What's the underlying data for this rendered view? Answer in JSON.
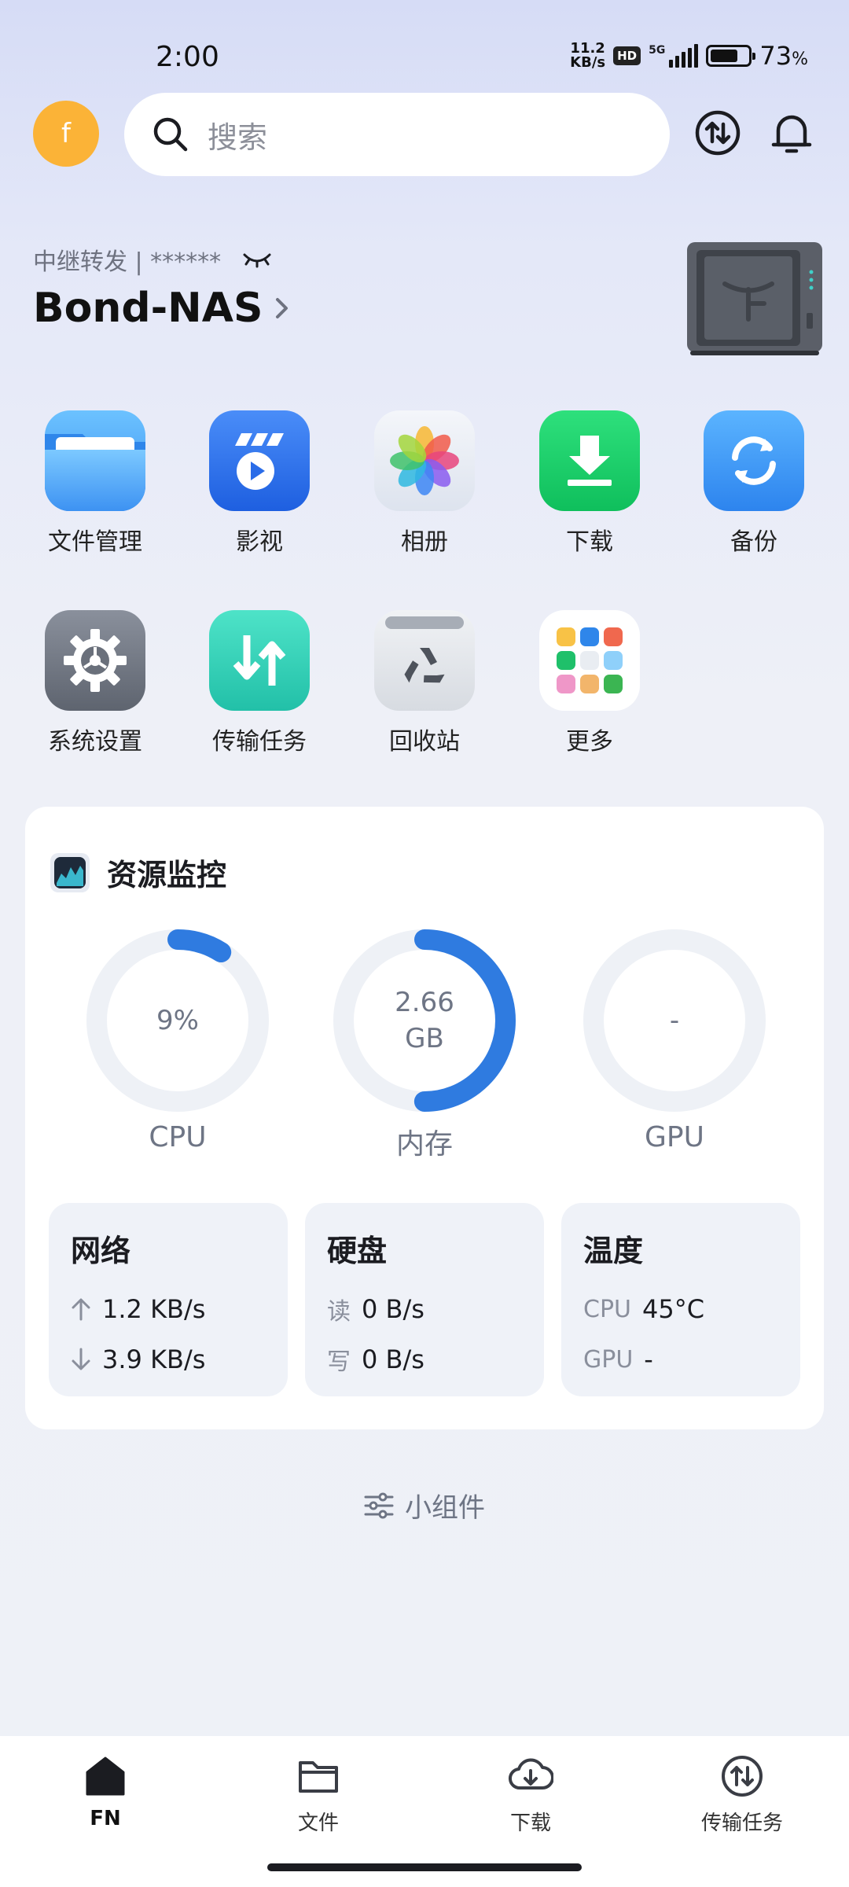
{
  "status_bar": {
    "time": "2:00",
    "net_speed_value": "11.2",
    "net_speed_unit": "KB/s",
    "hd": "HD",
    "network": "5G",
    "battery_level": 0.73,
    "battery_pct": "73",
    "battery_unit": "%"
  },
  "header": {
    "avatar_letter": "f",
    "search_placeholder": "搜索"
  },
  "device": {
    "relay": "中继转发 | ******",
    "name": "Bond-NAS"
  },
  "apps": [
    {
      "label": "文件管理",
      "icon": "folder-icon"
    },
    {
      "label": "影视",
      "icon": "video-icon"
    },
    {
      "label": "相册",
      "icon": "photos-icon"
    },
    {
      "label": "下载",
      "icon": "download-icon"
    },
    {
      "label": "备份",
      "icon": "backup-icon"
    },
    {
      "label": "系统设置",
      "icon": "settings-icon"
    },
    {
      "label": "传输任务",
      "icon": "transfer-icon"
    },
    {
      "label": "回收站",
      "icon": "recycle-bin-icon"
    },
    {
      "label": "更多",
      "icon": "more-apps-icon"
    }
  ],
  "monitor": {
    "title": "资源监控",
    "cpu": {
      "value": "9%",
      "label": "CPU",
      "fraction": 0.09
    },
    "memory": {
      "value": "2.66",
      "unit": "GB",
      "label": "内存",
      "fraction": 0.5
    },
    "gpu": {
      "value": "-",
      "label": "GPU",
      "fraction": 0
    },
    "network": {
      "title": "网络",
      "up": "1.2 KB/s",
      "down": "3.9 KB/s"
    },
    "disk": {
      "title": "硬盘",
      "read_label": "读",
      "read": "0 B/s",
      "write_label": "写",
      "write": "0 B/s"
    },
    "temperature": {
      "title": "温度",
      "cpu_label": "CPU",
      "cpu": "45°C",
      "gpu_label": "GPU",
      "gpu": "-"
    }
  },
  "widget_label": "小组件",
  "nav": [
    {
      "label": "FN",
      "icon": "home-icon",
      "active": true
    },
    {
      "label": "文件",
      "icon": "folder-icon"
    },
    {
      "label": "下载",
      "icon": "download-cloud-icon"
    },
    {
      "label": "传输任务",
      "icon": "transfer-icon"
    }
  ],
  "colors": {
    "accent": "#2f7be0",
    "avatar": "#fbb337",
    "card_bg": "#ffffff",
    "tile_bg": "#eff2f8"
  }
}
